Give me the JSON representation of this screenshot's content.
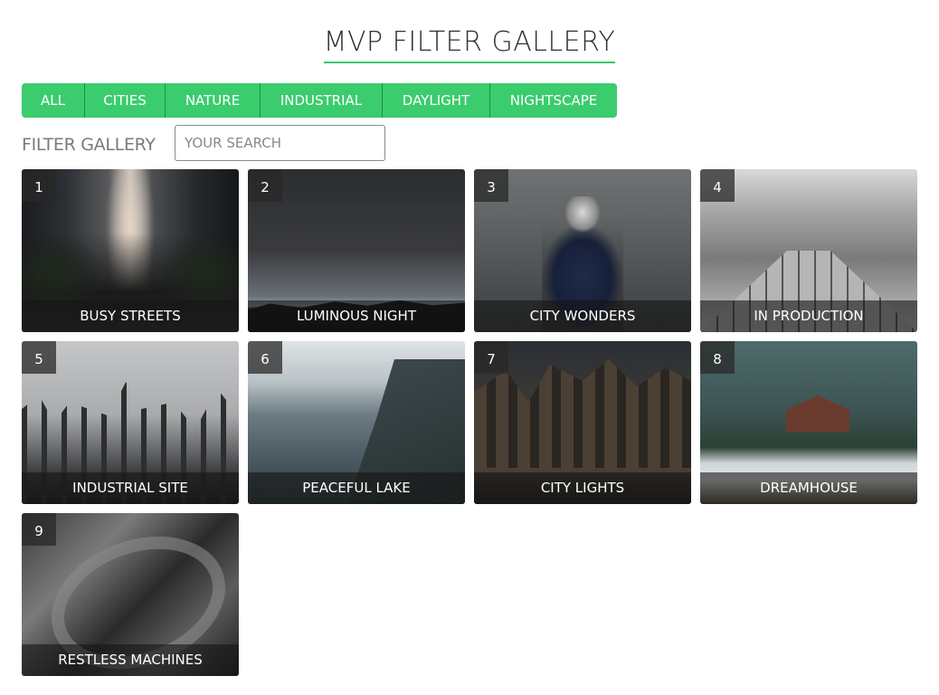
{
  "header": {
    "title": "MVP FILTER GALLERY"
  },
  "filters": [
    "ALL",
    "CITIES",
    "NATURE",
    "INDUSTRIAL",
    "DAYLIGHT",
    "NIGHTSCAPE"
  ],
  "search": {
    "label": "FILTER GALLERY",
    "placeholder": "YOUR SEARCH",
    "value": ""
  },
  "accent_color": "#3bcc6e",
  "gallery": [
    {
      "number": "1",
      "caption": "BUSY STREETS"
    },
    {
      "number": "2",
      "caption": "LUMINOUS NIGHT"
    },
    {
      "number": "3",
      "caption": "CITY WONDERS"
    },
    {
      "number": "4",
      "caption": "IN PRODUCTION"
    },
    {
      "number": "5",
      "caption": "INDUSTRIAL SITE"
    },
    {
      "number": "6",
      "caption": "PEACEFUL LAKE"
    },
    {
      "number": "7",
      "caption": "CITY LIGHTS"
    },
    {
      "number": "8",
      "caption": "DREAMHOUSE"
    },
    {
      "number": "9",
      "caption": "RESTLESS MACHINES"
    }
  ]
}
